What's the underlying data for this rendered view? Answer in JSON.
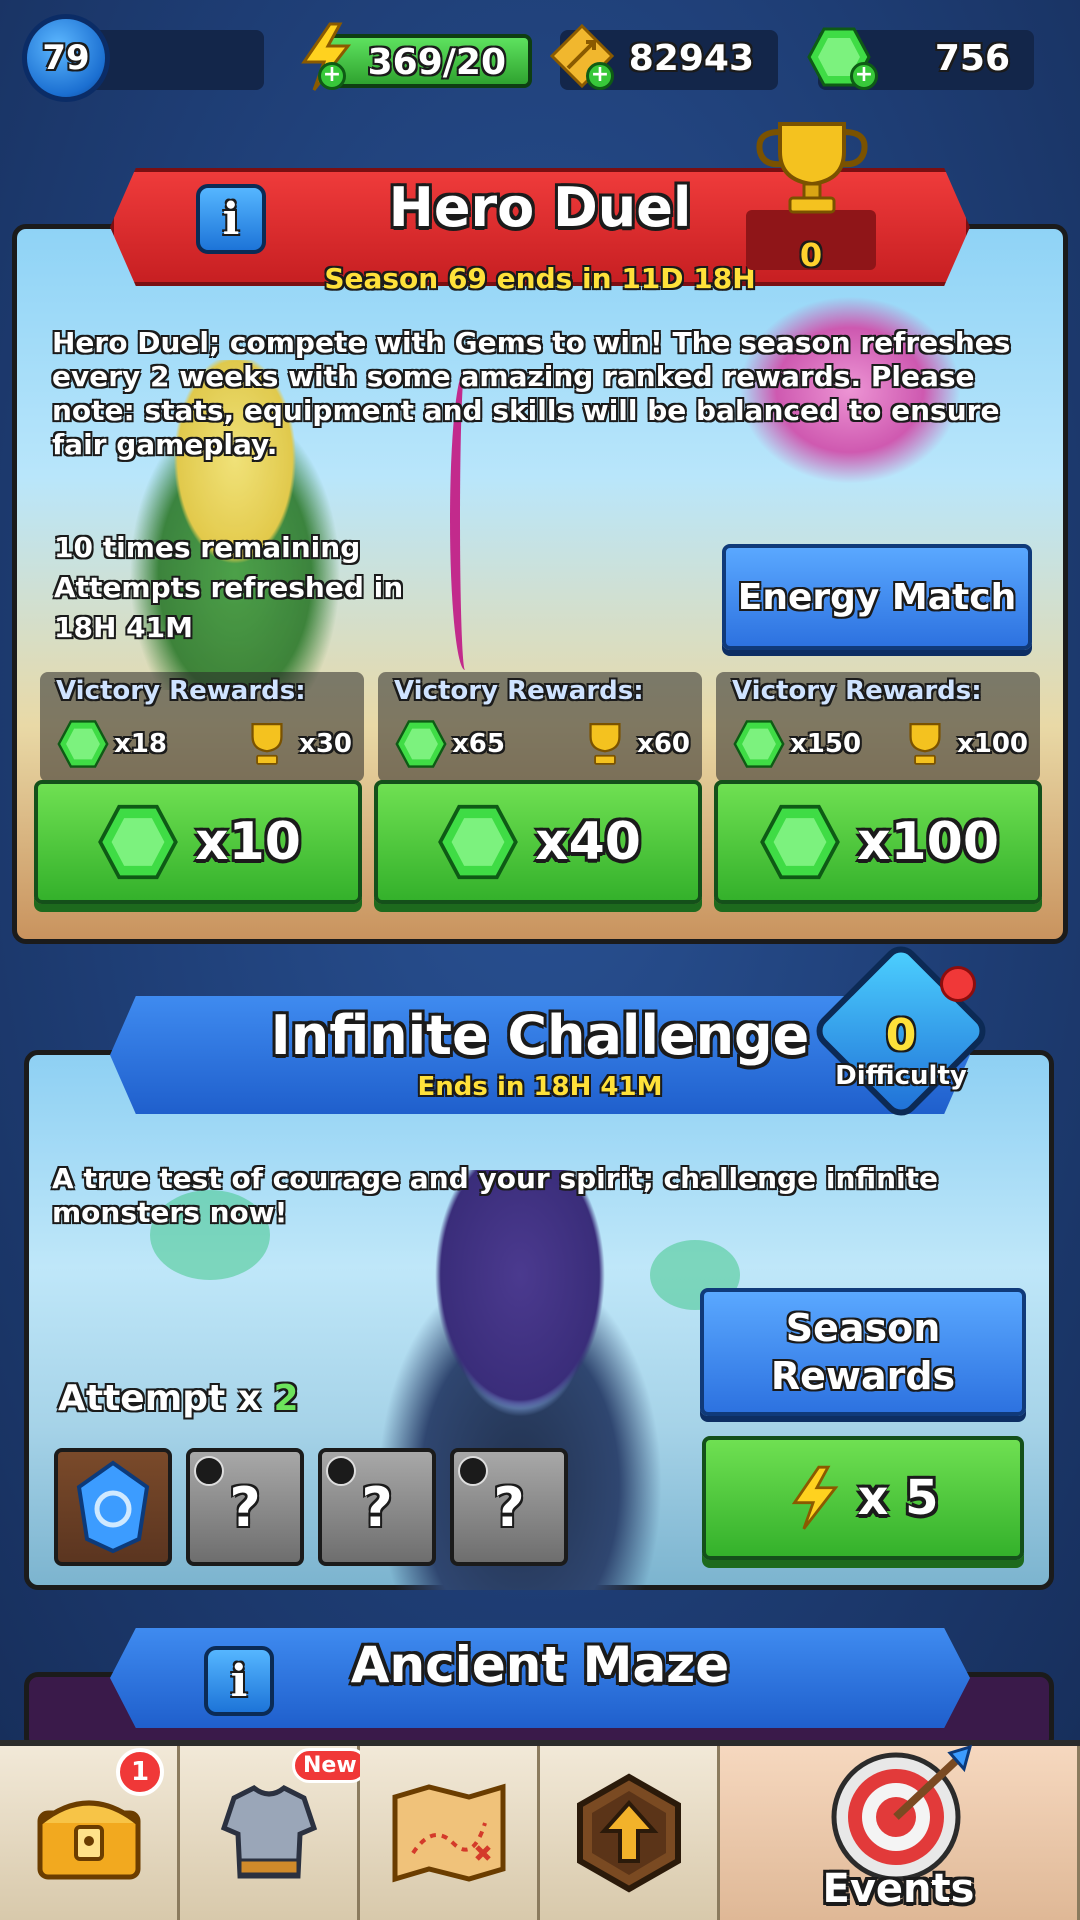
{
  "topbar": {
    "level": "79",
    "energy": "369/20",
    "arrows": "82943",
    "gems": "756",
    "colors": {
      "energy_fill": "#49c94a",
      "panel_bg": "#13264a"
    }
  },
  "hero_duel": {
    "title": "Hero Duel",
    "season": "Season 69 ends in 11D 18H",
    "trophy_count": "0",
    "description": "Hero Duel; compete with Gems to win! The season refreshes every 2 weeks with some amazing ranked rewards. Please note: stats, equipment and skills will be balanced to ensure fair gameplay.",
    "attempts_line1": "10 times remaining",
    "attempts_line2": "Attempts refreshed in",
    "attempts_line3": "18H 41M",
    "energy_match_label": "Energy Match",
    "rewards": [
      {
        "label": "Victory Rewards:",
        "gems": "x18",
        "trophies": "x30",
        "cost": "x10"
      },
      {
        "label": "Victory Rewards:",
        "gems": "x65",
        "trophies": "x60",
        "cost": "x40"
      },
      {
        "label": "Victory Rewards:",
        "gems": "x150",
        "trophies": "x100",
        "cost": "x100"
      }
    ]
  },
  "infinite": {
    "title": "Infinite Challenge",
    "ends": "Ends in 18H 41M",
    "difficulty_value": "0",
    "difficulty_label": "Difficulty",
    "description": "A true test of courage and your spirit; challenge infinite monsters now!",
    "attempt_label": "Attempt x",
    "attempt_count": "2",
    "season_rewards_line1": "Season",
    "season_rewards_line2": "Rewards",
    "energy_cost": "x 5"
  },
  "maze": {
    "title": "Ancient Maze"
  },
  "nav": {
    "chest_badge": "1",
    "armor_badge": "New",
    "events_label": "Events"
  },
  "icons": [
    "gem-icon",
    "energy-bolt-icon",
    "arrow-coin-icon",
    "trophy-icon",
    "info-icon",
    "chest-icon",
    "armor-icon",
    "map-icon",
    "upgrade-icon",
    "target-icon"
  ]
}
